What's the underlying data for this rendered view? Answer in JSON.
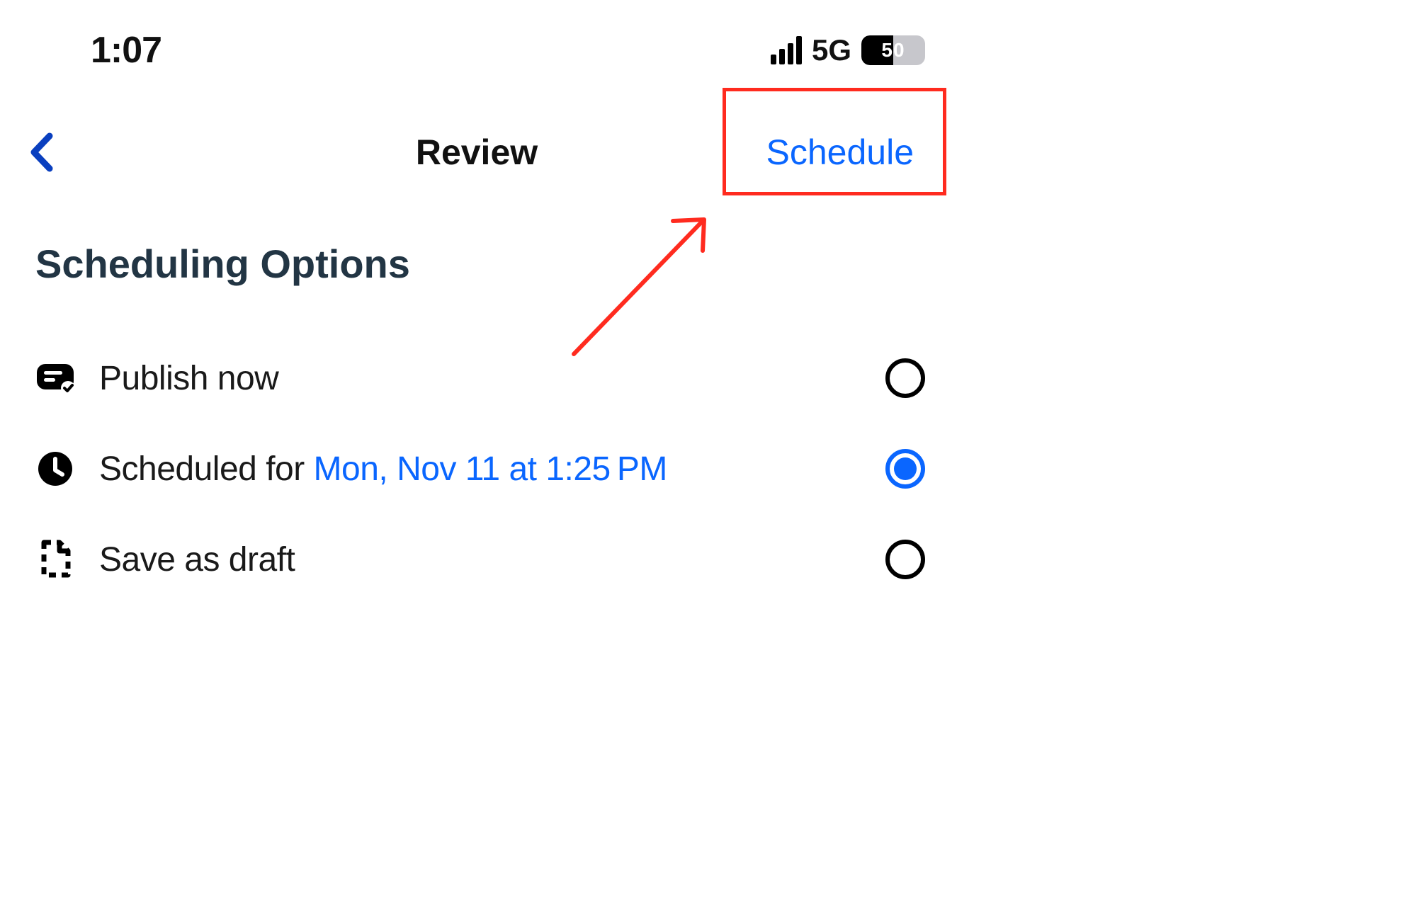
{
  "status": {
    "time": "1:07",
    "network": "5G",
    "battery_percent": "50"
  },
  "nav": {
    "title": "Review",
    "action_label": "Schedule"
  },
  "section": {
    "title": "Scheduling Options"
  },
  "options": {
    "publish_now": {
      "label": "Publish now",
      "selected": false
    },
    "scheduled": {
      "prefix": "Scheduled for ",
      "date": "Mon, Nov 11 at 1:25 PM",
      "selected": true
    },
    "save_draft": {
      "label": "Save as draft",
      "selected": false
    }
  }
}
